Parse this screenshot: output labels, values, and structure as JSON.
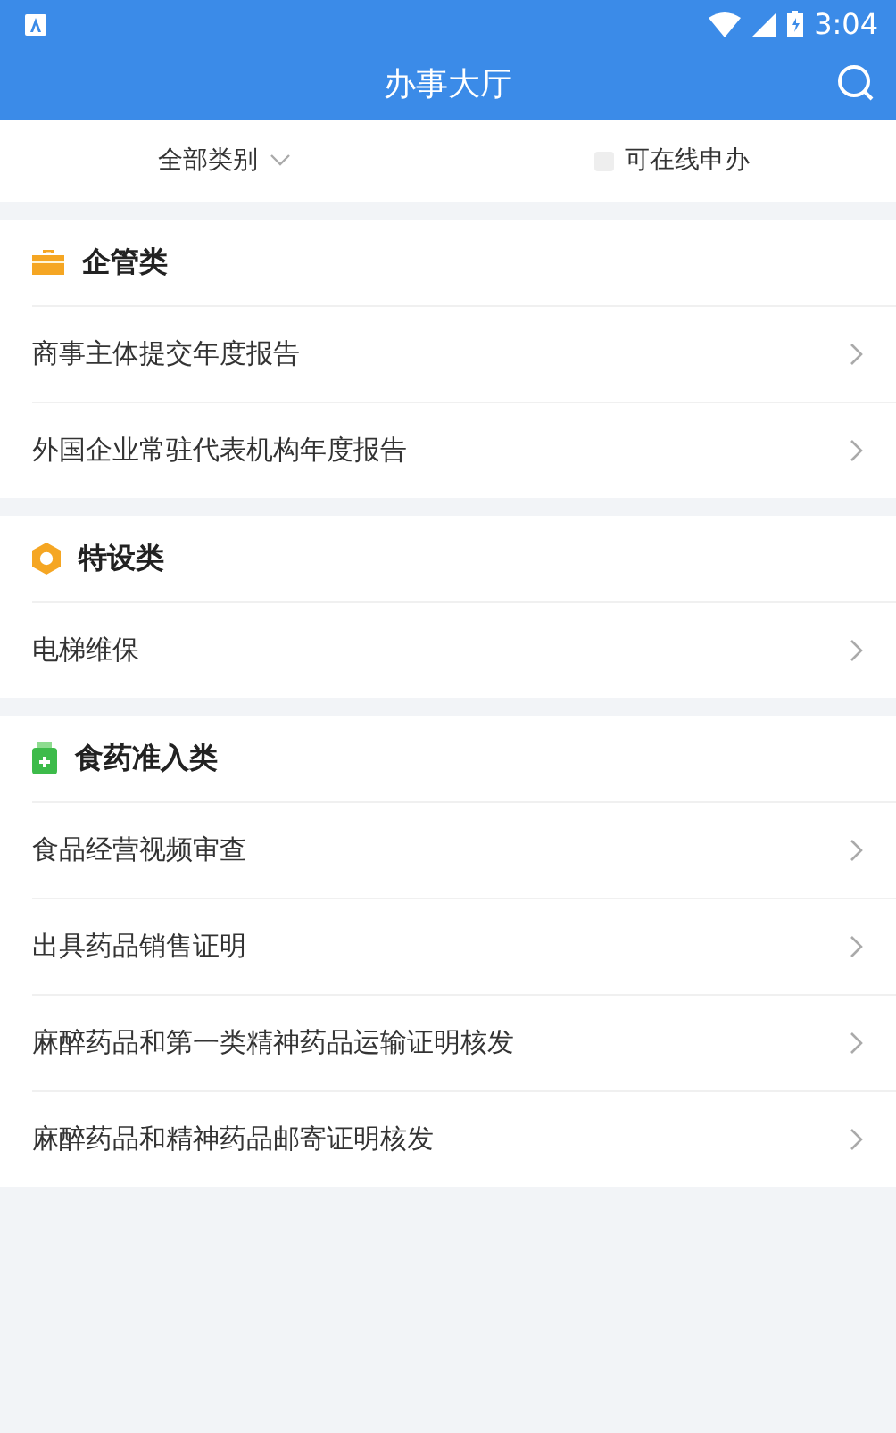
{
  "status_bar": {
    "time": "3:04"
  },
  "header": {
    "title": "办事大厅"
  },
  "filters": {
    "category": {
      "label": "全部类别"
    },
    "online": {
      "label": "可在线申办",
      "checked": false
    }
  },
  "sections": [
    {
      "title": "企管类",
      "kind": "briefcase",
      "items": [
        "商事主体提交年度报告",
        "外国企业常驻代表机构年度报告"
      ]
    },
    {
      "title": "特设类",
      "kind": "hexagon",
      "items": [
        "电梯维保"
      ]
    },
    {
      "title": "食药准入类",
      "kind": "bottle",
      "items": [
        "食品经营视频审查",
        "出具药品销售证明",
        "麻醉药品和第一类精神药品运输证明核发",
        "麻醉药品和精神药品邮寄证明核发"
      ]
    }
  ]
}
